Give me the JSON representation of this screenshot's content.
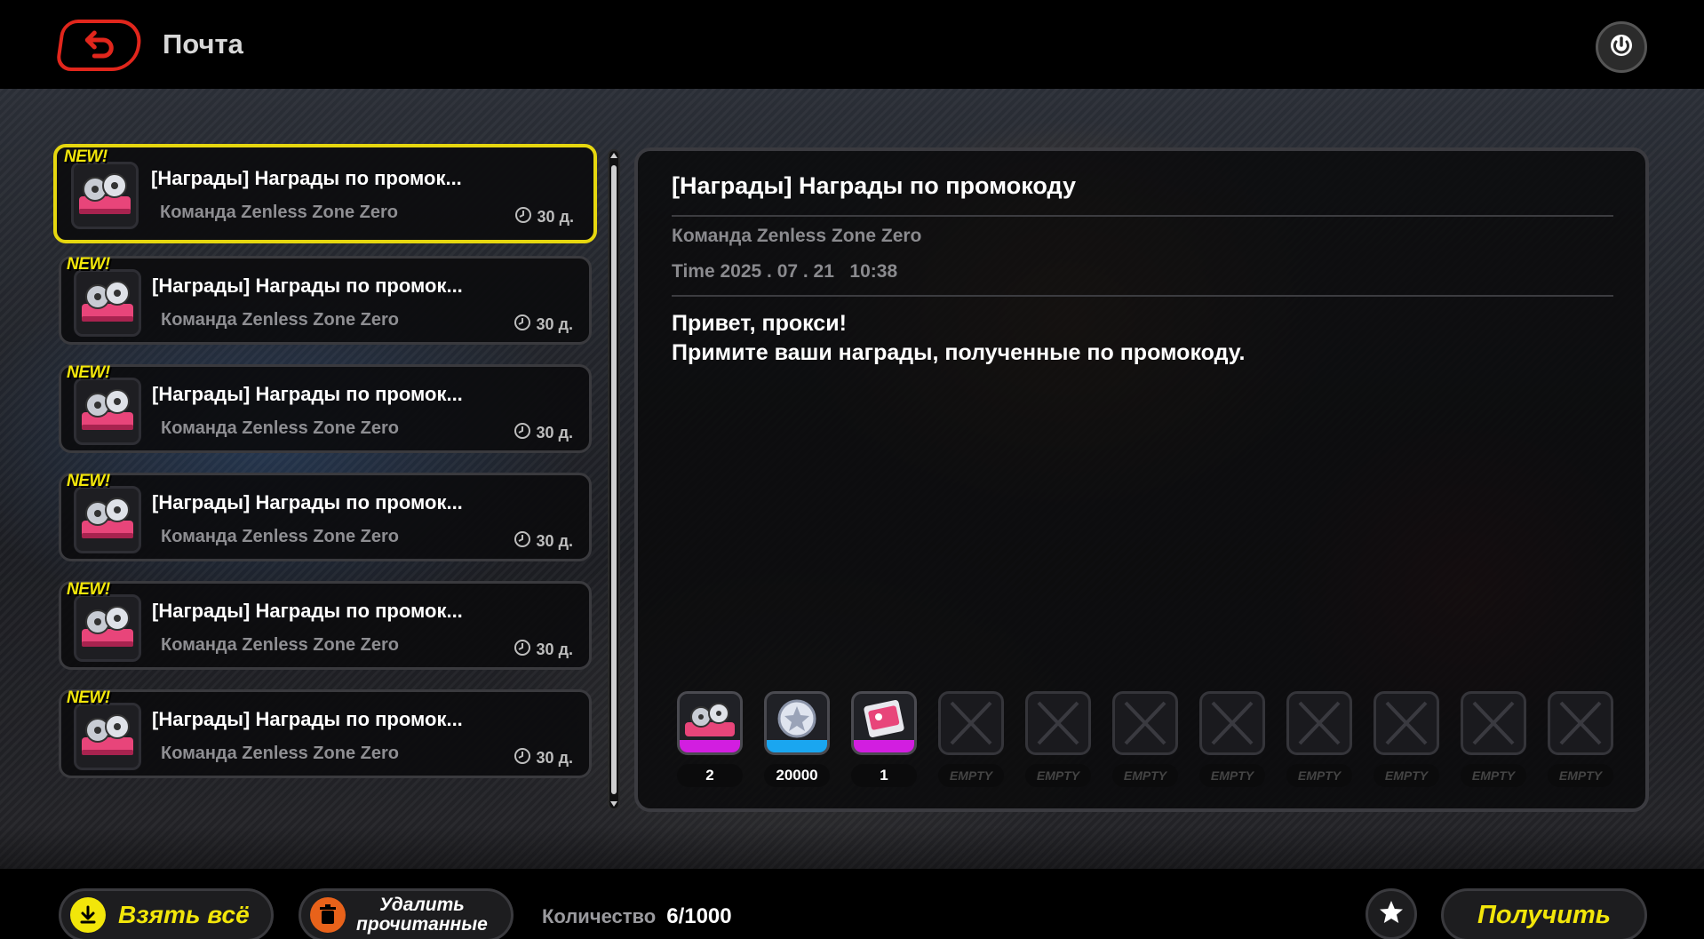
{
  "header": {
    "title": "Почта",
    "back_icon": "back-arrow-icon",
    "power_icon": "power-icon"
  },
  "mail_list": {
    "items": [
      {
        "new_tag": "NEW!",
        "title": "[Награды] Награды по промок...",
        "sender": "Команда Zenless Zone Zero",
        "expire": "30 д.",
        "selected": true
      },
      {
        "new_tag": "NEW!",
        "title": "[Награды] Награды по промок...",
        "sender": "Команда Zenless Zone Zero",
        "expire": "30 д.",
        "selected": false
      },
      {
        "new_tag": "NEW!",
        "title": "[Награды] Награды по промок...",
        "sender": "Команда Zenless Zone Zero",
        "expire": "30 д.",
        "selected": false
      },
      {
        "new_tag": "NEW!",
        "title": "[Награды] Награды по промок...",
        "sender": "Команда Zenless Zone Zero",
        "expire": "30 д.",
        "selected": false
      },
      {
        "new_tag": "NEW!",
        "title": "[Награды] Награды по промок...",
        "sender": "Команда Zenless Zone Zero",
        "expire": "30 д.",
        "selected": false
      },
      {
        "new_tag": "NEW!",
        "title": "[Награды] Награды по промок...",
        "sender": "Команда Zenless Zone Zero",
        "expire": "30 д.",
        "selected": false
      }
    ]
  },
  "detail": {
    "title": "[Награды] Награды по промокоду",
    "sender": "Команда Zenless Zone Zero",
    "time": "Time 2025 . 07 . 21   10:38",
    "body_line1": "Привет, прокси!",
    "body_line2": "Примите ваши награды, полученные по промокоду.",
    "rewards": [
      {
        "icon": "film-reels-icon",
        "count": "2",
        "rarity_color": "#d21ee0"
      },
      {
        "icon": "denny-coin-icon",
        "count": "20000",
        "rarity_color": "#1aa6f0"
      },
      {
        "icon": "ticket-card-icon",
        "count": "1",
        "rarity_color": "#d21ee0"
      },
      {
        "icon": "empty-slot-icon",
        "count": "EMPTY"
      },
      {
        "icon": "empty-slot-icon",
        "count": "EMPTY"
      },
      {
        "icon": "empty-slot-icon",
        "count": "EMPTY"
      },
      {
        "icon": "empty-slot-icon",
        "count": "EMPTY"
      },
      {
        "icon": "empty-slot-icon",
        "count": "EMPTY"
      },
      {
        "icon": "empty-slot-icon",
        "count": "EMPTY"
      },
      {
        "icon": "empty-slot-icon",
        "count": "EMPTY"
      },
      {
        "icon": "empty-slot-icon",
        "count": "EMPTY"
      }
    ]
  },
  "footer": {
    "take_all_label": "Взять всё",
    "delete_line1": "Удалить",
    "delete_line2": "прочитанные",
    "quantity_label": "Количество",
    "quantity_value": "6/1000",
    "receive_label": "Получить",
    "star_icon": "star-icon"
  },
  "colors": {
    "accent_yellow": "#f2e60a",
    "back_red": "#e1261c",
    "delete_orange": "#e8621a",
    "rarity_purple": "#d21ee0",
    "rarity_blue": "#1aa6f0"
  }
}
